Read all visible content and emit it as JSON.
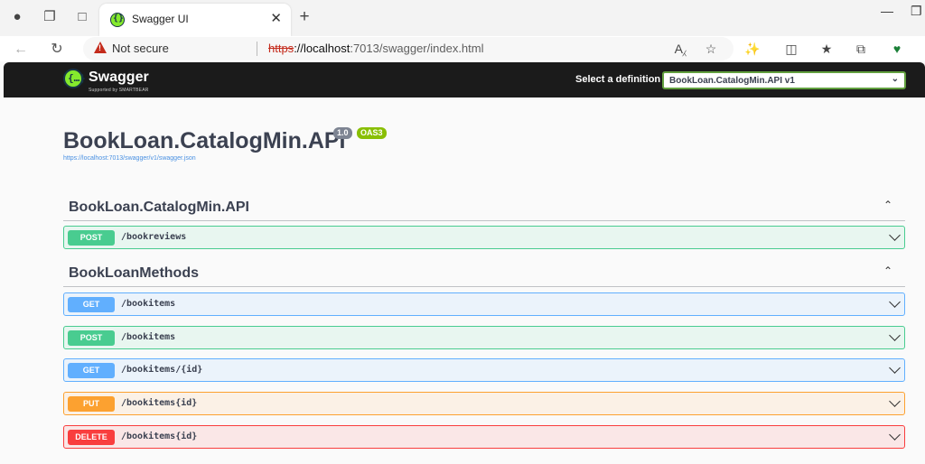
{
  "browser": {
    "tab_title": "Swagger UI",
    "security_text": "Not secure",
    "url_scheme": "https",
    "url_host": "://localhost",
    "url_rest": ":7013/swagger/index.html"
  },
  "header": {
    "logo_name": "Swagger",
    "logo_sub": "Supported by SMARTBEAR",
    "definition_label": "Select a definition",
    "definition_value": "BookLoan.CatalogMin.API v1"
  },
  "info": {
    "title": "BookLoan.CatalogMin.API",
    "version": "1.0",
    "oas": "OAS3",
    "spec_url": "https://localhost:7013/swagger/v1/swagger.json"
  },
  "tags": [
    {
      "name": "BookLoan.CatalogMin.API",
      "ops": [
        {
          "method": "POST",
          "path": "/bookreviews"
        }
      ]
    },
    {
      "name": "BookLoanMethods",
      "ops": [
        {
          "method": "GET",
          "path": "/bookitems"
        },
        {
          "method": "POST",
          "path": "/bookitems"
        },
        {
          "method": "GET",
          "path": "/bookitems/{id}"
        },
        {
          "method": "PUT",
          "path": "/bookitems{id}"
        },
        {
          "method": "DELETE",
          "path": "/bookitems{id}"
        }
      ]
    }
  ],
  "colors": {
    "post": "#49cc90",
    "get": "#61affe",
    "put": "#fca130",
    "delete": "#f93e3e",
    "brand": "#85ea2d"
  }
}
